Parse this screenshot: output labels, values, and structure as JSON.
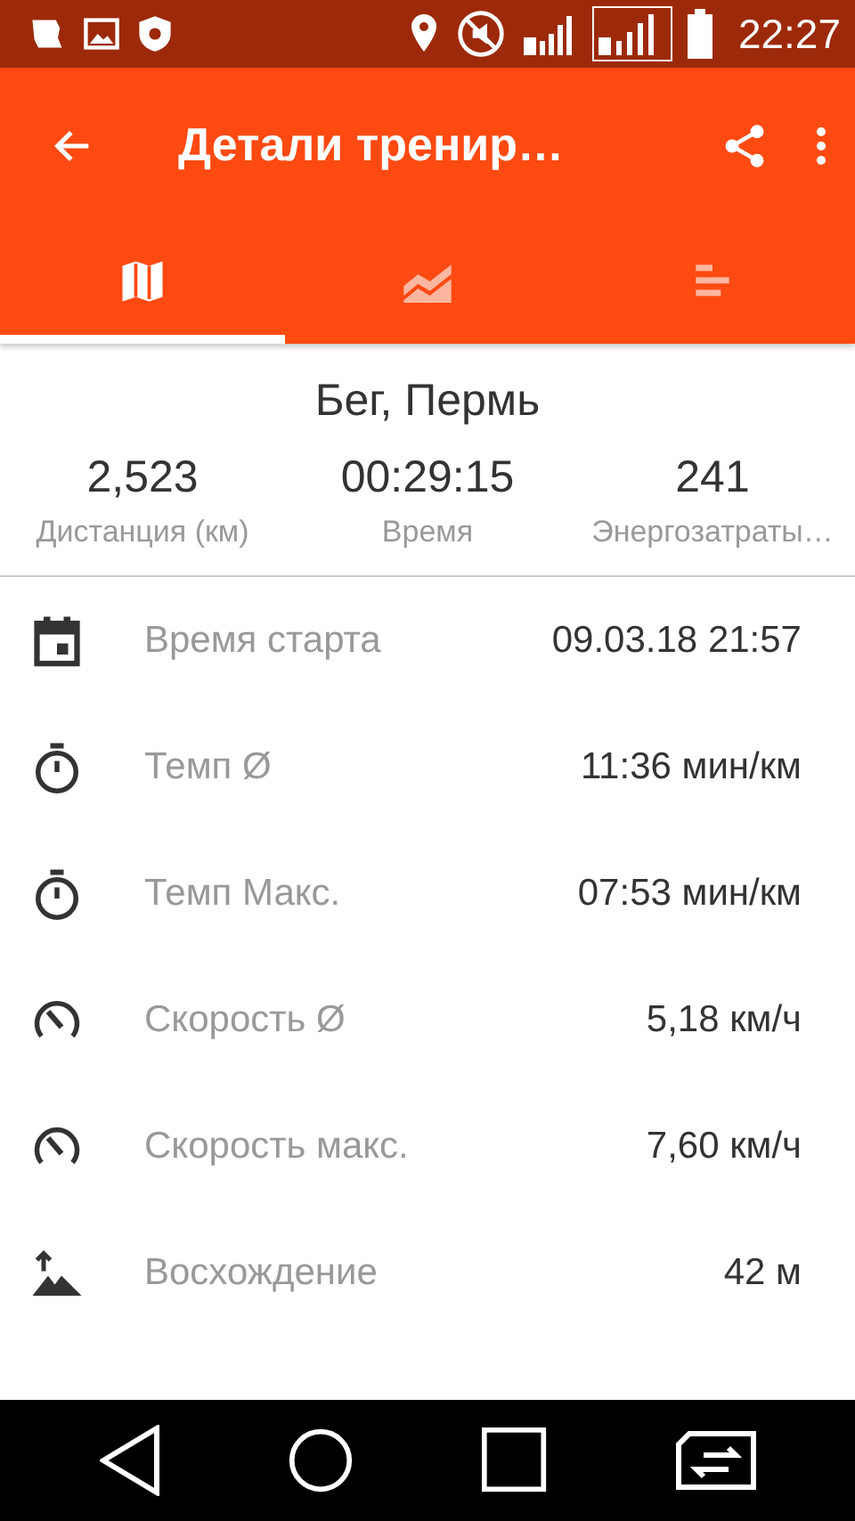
{
  "status_bar": {
    "time": "22:27"
  },
  "toolbar": {
    "title": "Детали тренир…"
  },
  "tabs": [
    {
      "kind": "map",
      "selected": true
    },
    {
      "kind": "chart",
      "selected": false
    },
    {
      "kind": "bars",
      "selected": false
    }
  ],
  "summary": {
    "title": "Бег, Пермь",
    "stats": [
      {
        "value": "2,523",
        "label": "Дистанция (км)"
      },
      {
        "value": "00:29:15",
        "label": "Время"
      },
      {
        "value": "241",
        "label": "Энергозатраты…"
      }
    ]
  },
  "details": [
    {
      "kind": "calendar",
      "label": "Время старта",
      "value": "09.03.18 21:57"
    },
    {
      "kind": "timer",
      "label": "Темп Ø",
      "value": "11:36 мин/км"
    },
    {
      "kind": "timer",
      "label": "Темп Макс.",
      "value": "07:53 мин/км"
    },
    {
      "kind": "speed",
      "label": "Скорость Ø",
      "value": "5,18 км/ч"
    },
    {
      "kind": "speed",
      "label": "Скорость макс.",
      "value": "7,60 км/ч"
    },
    {
      "kind": "ascent",
      "label": "Восхождение",
      "value": "42 м"
    }
  ]
}
